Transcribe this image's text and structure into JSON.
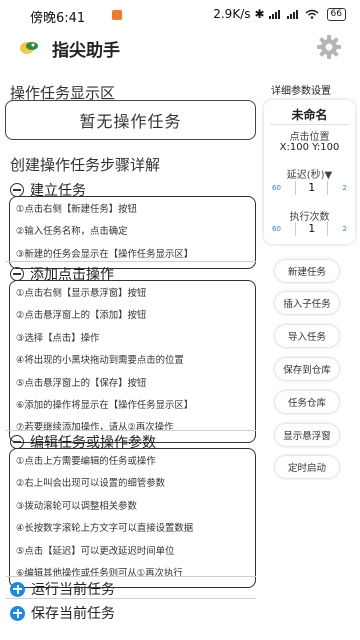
{
  "status_bar": {
    "time": "傍晚6:41",
    "speed": "2.9K/s",
    "battery": "66"
  },
  "header": {
    "title": "指尖助手"
  },
  "display_area": {
    "title": "操作任务显示区",
    "empty_text": "暂无操作任务"
  },
  "steps_title": "创建操作任务步骤详解",
  "groups": [
    {
      "title": "建立任务",
      "steps": [
        "①点击右侧【新建任务】按钮",
        "②输入任务名称，点击确定",
        "③新建的任务会显示在【操作任务显示区】"
      ]
    },
    {
      "title": "添加点击操作",
      "steps": [
        "①点击右侧【显示悬浮窗】按钮",
        "②点击悬浮窗上的【添加】按钮",
        "③选择【点击】操作",
        "④将出现的小黑块拖动到需要点击的位置",
        "⑤点击悬浮窗上的【保存】按钮",
        "⑥添加的操作将显示在【操作任务显示区】",
        "⑦若要继续添加操作，请从②再次操作"
      ]
    },
    {
      "title": "编辑任务或操作参数",
      "steps": [
        "①点击上方需要编辑的任务或操作",
        "②右上叫会出现可以设置的细管参数",
        "③拨动滚轮可以调整相关参数",
        "④长按数字滚轮上方文字可以直接设置数据",
        "⑤点击【延迟】可以更改延迟时间单位",
        "⑥编辑其他操作或任务则可从①再次执行"
      ]
    }
  ],
  "collapsed_groups": [
    "运行当前任务",
    "保存当前任务"
  ],
  "right_panel": {
    "title": "详细参数设置",
    "name": "未命名",
    "click_pos_label": "点击位置",
    "click_pos": "X:100  Y:100",
    "delay_label": "延迟(秒)▼",
    "delay": {
      "prev": "60",
      "value": "1",
      "next": "2"
    },
    "exec_label": "执行次数",
    "exec": {
      "prev": "60",
      "value": "1",
      "next": "2"
    },
    "buttons": [
      "新建任务",
      "插入子任务",
      "导入任务",
      "保存到仓库",
      "任务仓库",
      "显示悬浮窗",
      "定时启动"
    ]
  },
  "colors": {
    "accent": "#1e88e5",
    "border": "#333333"
  }
}
